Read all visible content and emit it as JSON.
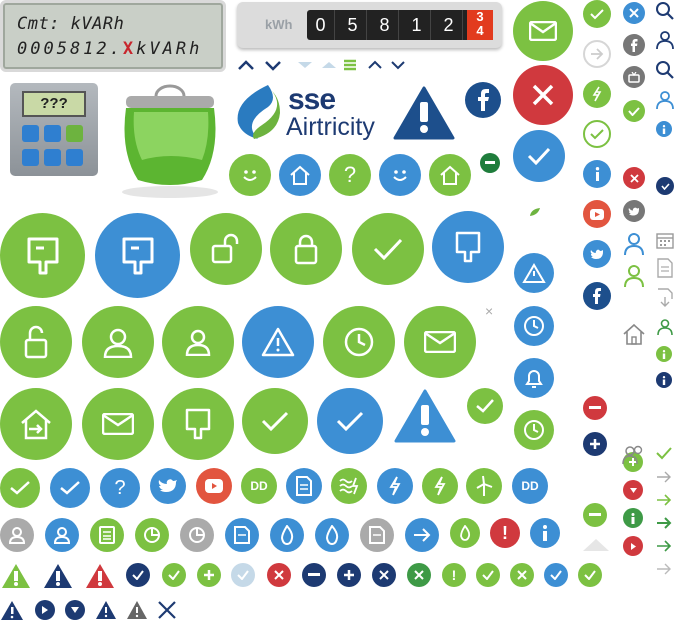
{
  "lcd": {
    "line1": "Cmt: kVARh",
    "line2_digits": "0005812",
    "line2_dot": ".",
    "line2_mark": "X",
    "line2_unit": "kVARh"
  },
  "meter": {
    "unit": "kWh",
    "digits": [
      "0",
      "5",
      "8",
      "1",
      "2"
    ],
    "red_digits": "3\n4"
  },
  "calculator": {
    "display": "???"
  },
  "brand": {
    "name": "sse",
    "sub": "Airtricity"
  },
  "colors": {
    "green": "#7cc142",
    "blue": "#3d8fd4",
    "navy": "#1d3a72",
    "red": "#d0393e",
    "grey": "#aaaaaa",
    "light": "#c5d9e8"
  },
  "labels": {
    "dd": "DD",
    "question": "?",
    "exclamation": "!",
    "close_x": "×"
  }
}
